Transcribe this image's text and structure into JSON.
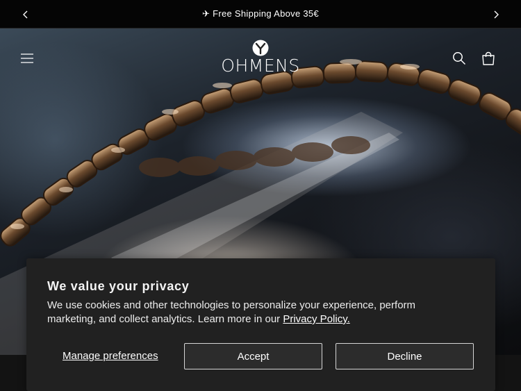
{
  "announcement": {
    "text": "✈ Free Shipping Above 35€",
    "prev_icon": "chevron-left-icon",
    "next_icon": "chevron-right-icon"
  },
  "header": {
    "logo_text": "OHMENS",
    "menu_icon": "hamburger-menu-icon",
    "search_icon": "search-icon",
    "cart_icon": "cart-icon"
  },
  "cookie_banner": {
    "title": "We value your privacy",
    "body": "We use cookies and other technologies to personalize your experience, perform marketing, and collect analytics. Learn more in our ",
    "policy_link": "Privacy Policy.",
    "manage_label": "Manage preferences",
    "accept_label": "Accept",
    "decline_label": "Decline"
  },
  "colors": {
    "banner_bg": "#212121",
    "announcement_bg": "#050505",
    "text": "#ffffff"
  }
}
